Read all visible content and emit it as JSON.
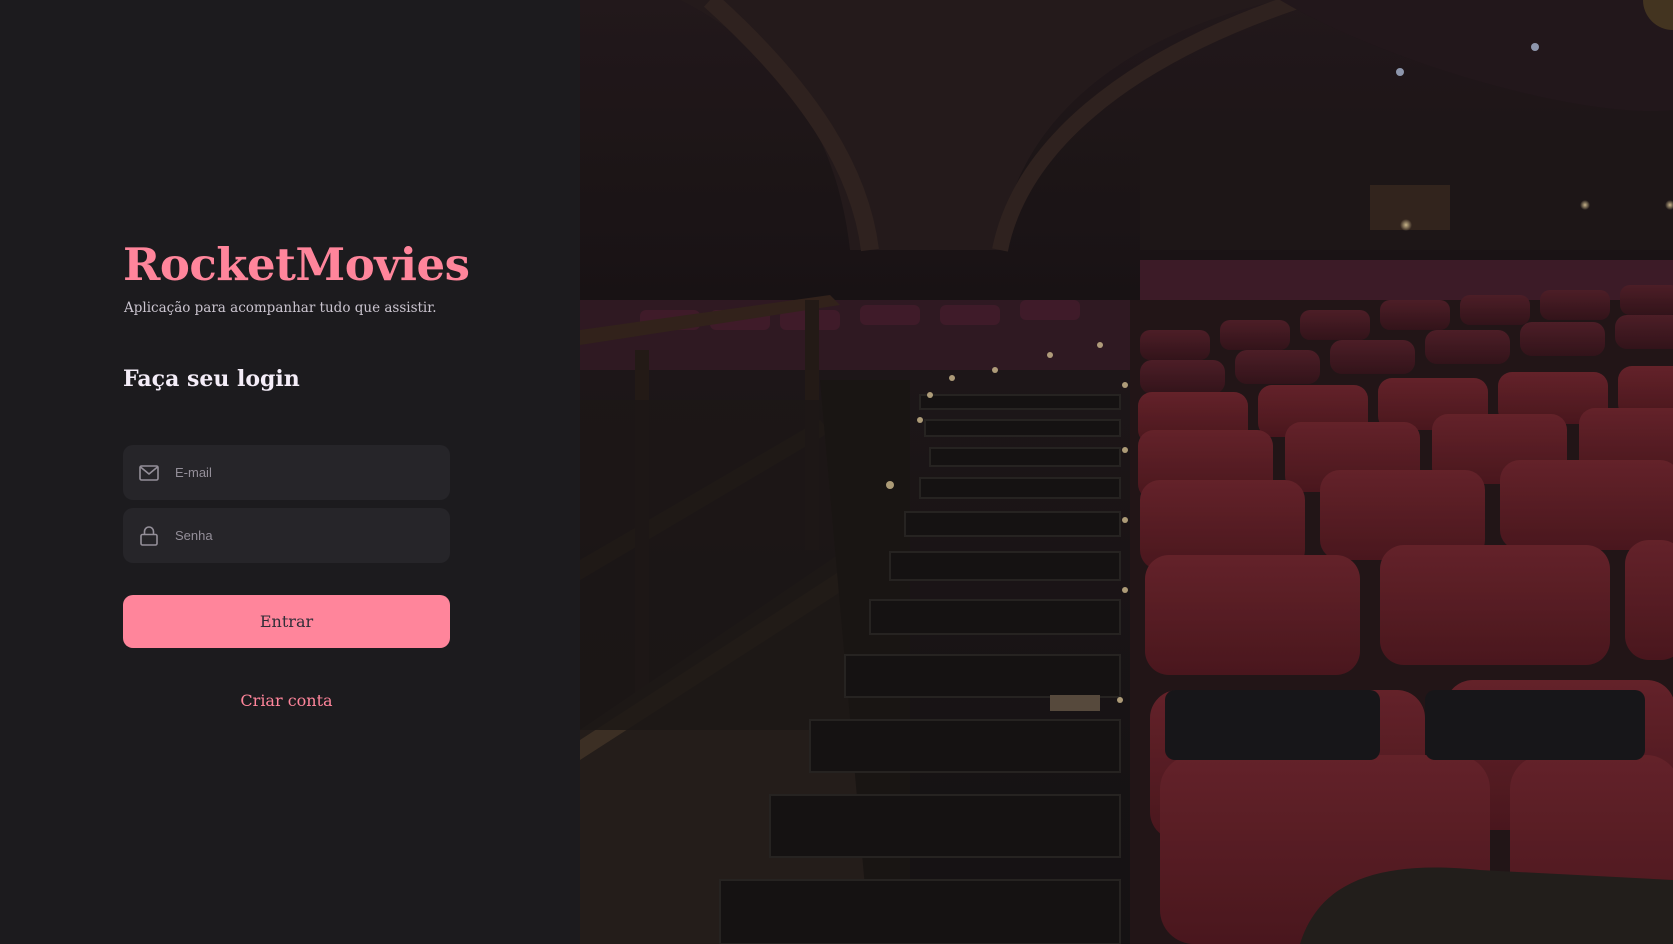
{
  "brand": {
    "title": "RocketMovies",
    "subtitle": "Aplicação para acompanhar tudo que assistir."
  },
  "login": {
    "heading": "Faça seu login",
    "email": {
      "placeholder": "E-mail",
      "value": "",
      "icon": "mail-icon"
    },
    "password": {
      "placeholder": "Senha",
      "value": "",
      "icon": "lock-icon"
    },
    "submit_label": "Entrar",
    "create_account_label": "Criar conta"
  },
  "background": {
    "description_icon": "cinema-auditorium-image"
  },
  "colors": {
    "accent": "#ff859b",
    "panel": "#1c1b1e",
    "input": "#262529",
    "text": "#f4edf8",
    "muted": "#948f99"
  }
}
